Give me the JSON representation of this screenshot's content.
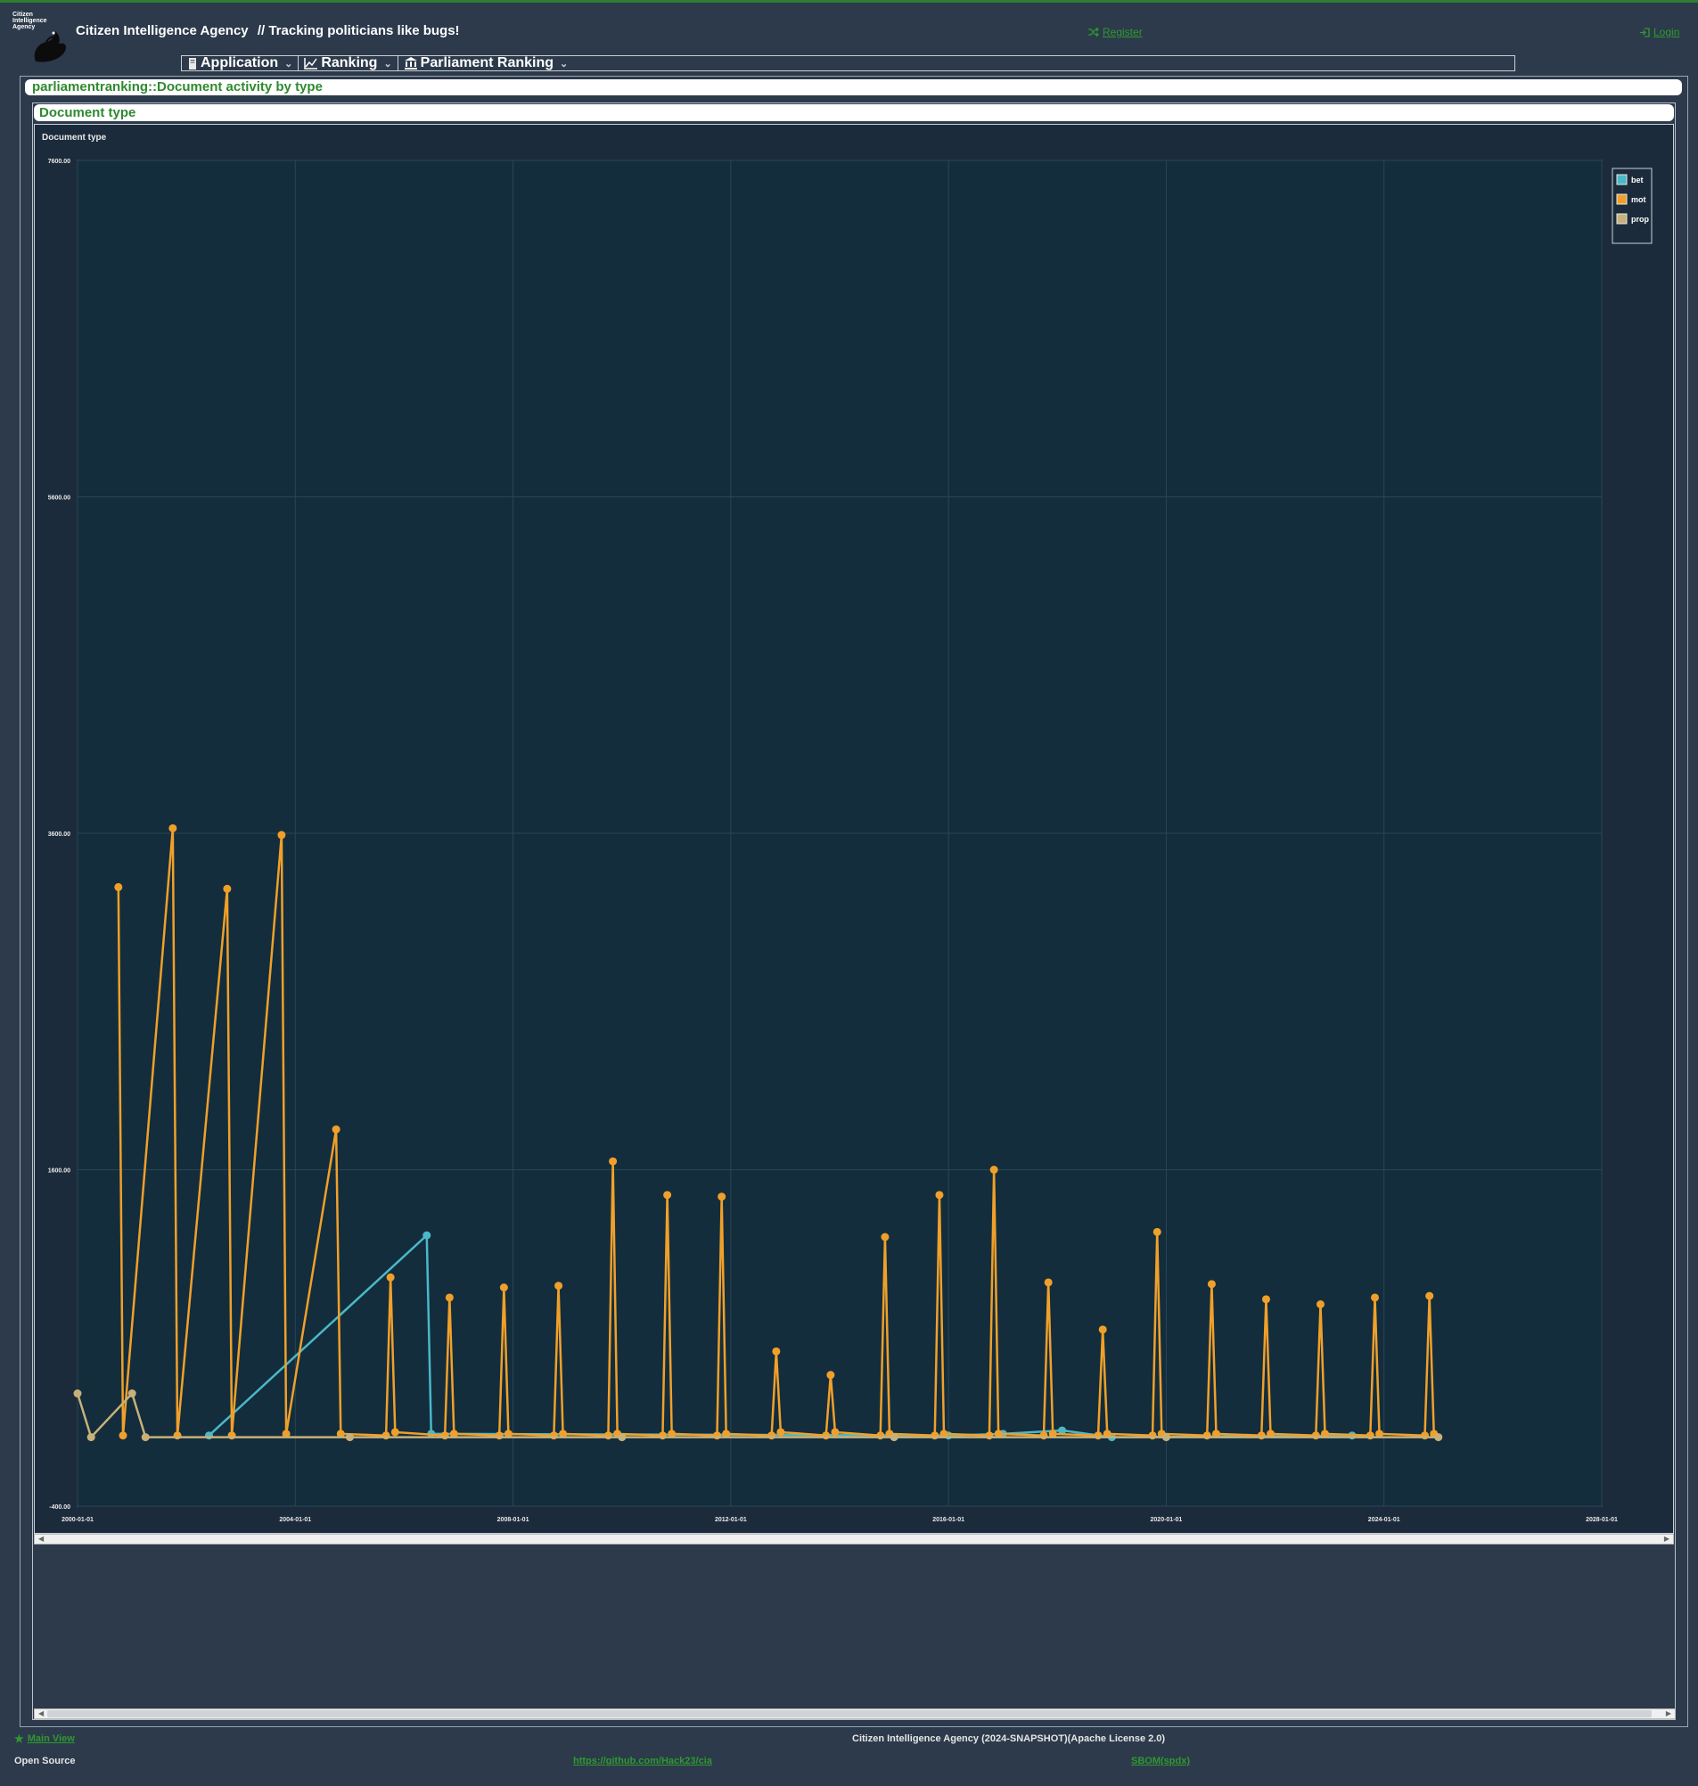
{
  "header": {
    "logo_text": "Citizen Intelligence Agency",
    "title": "Citizen Intelligence Agency",
    "tagline": "// Tracking politicians like bugs!",
    "register_label": "Register",
    "login_label": "Login"
  },
  "menu": [
    {
      "label": "Application",
      "icon": "document-icon"
    },
    {
      "label": "Ranking",
      "icon": "line-chart-icon"
    },
    {
      "label": "Parliament Ranking",
      "icon": "institution-icon"
    }
  ],
  "page_header": "parliamentranking::Document activity by type",
  "panel_header": "Document type",
  "chart_data": {
    "type": "line",
    "title": "Document type",
    "xlabel": "",
    "ylabel": "",
    "x_ticks": [
      "2000-01-01",
      "2004-01-01",
      "2008-01-01",
      "2012-01-01",
      "2016-01-01",
      "2020-01-01",
      "2024-01-01",
      "2028-01-01"
    ],
    "y_ticks": [
      "7600.00",
      "5600.00",
      "3600.00",
      "1600.00",
      "-400.00"
    ],
    "xlim": [
      "2000-01-01",
      "2028-01-01"
    ],
    "ylim": [
      -400,
      7600
    ],
    "grid": true,
    "legend_position": "top-right",
    "series": [
      {
        "name": "bet",
        "color": "#4ab8c8",
        "points": [
          [
            "2002-06-01",
            20
          ],
          [
            "2006-06-01",
            1210
          ],
          [
            "2006-07-01",
            30
          ],
          [
            "2016-01-01",
            20
          ],
          [
            "2017-01-01",
            30
          ],
          [
            "2018-02-01",
            50
          ],
          [
            "2019-01-01",
            10
          ],
          [
            "2023-06-01",
            20
          ]
        ]
      },
      {
        "name": "mot",
        "color": "#f0a02a",
        "points": [
          [
            "2000-10-01",
            3280
          ],
          [
            "2000-11-01",
            20
          ],
          [
            "2001-10-01",
            3630
          ],
          [
            "2001-11-01",
            20
          ],
          [
            "2002-10-01",
            3270
          ],
          [
            "2002-11-01",
            20
          ],
          [
            "2003-10-01",
            3590
          ],
          [
            "2003-11-01",
            30
          ],
          [
            "2004-10-01",
            1840
          ],
          [
            "2004-11-01",
            30
          ],
          [
            "2005-09-01",
            20
          ],
          [
            "2005-10-01",
            960
          ],
          [
            "2005-11-01",
            40
          ],
          [
            "2006-10-01",
            20
          ],
          [
            "2006-11-01",
            840
          ],
          [
            "2006-12-01",
            30
          ],
          [
            "2007-10-01",
            20
          ],
          [
            "2007-11-01",
            900
          ],
          [
            "2007-12-01",
            30
          ],
          [
            "2008-10-01",
            20
          ],
          [
            "2008-11-01",
            910
          ],
          [
            "2008-12-01",
            30
          ],
          [
            "2009-10-01",
            20
          ],
          [
            "2009-11-01",
            1650
          ],
          [
            "2009-12-01",
            30
          ],
          [
            "2010-10-01",
            20
          ],
          [
            "2010-11-01",
            1450
          ],
          [
            "2010-12-01",
            30
          ],
          [
            "2011-10-01",
            20
          ],
          [
            "2011-11-01",
            1440
          ],
          [
            "2011-12-01",
            30
          ],
          [
            "2012-10-01",
            20
          ],
          [
            "2012-11-01",
            520
          ],
          [
            "2012-12-01",
            40
          ],
          [
            "2013-10-01",
            20
          ],
          [
            "2013-11-01",
            380
          ],
          [
            "2013-12-01",
            40
          ],
          [
            "2014-10-01",
            20
          ],
          [
            "2014-11-01",
            1200
          ],
          [
            "2014-12-01",
            30
          ],
          [
            "2015-10-01",
            20
          ],
          [
            "2015-11-01",
            1450
          ],
          [
            "2015-12-01",
            30
          ],
          [
            "2016-10-01",
            20
          ],
          [
            "2016-11-01",
            1600
          ],
          [
            "2016-12-01",
            30
          ],
          [
            "2017-10-01",
            20
          ],
          [
            "2017-11-01",
            930
          ],
          [
            "2017-12-01",
            30
          ],
          [
            "2018-10-01",
            20
          ],
          [
            "2018-11-01",
            650
          ],
          [
            "2018-12-01",
            30
          ],
          [
            "2019-10-01",
            20
          ],
          [
            "2019-11-01",
            1230
          ],
          [
            "2019-12-01",
            30
          ],
          [
            "2020-10-01",
            20
          ],
          [
            "2020-11-01",
            920
          ],
          [
            "2020-12-01",
            30
          ],
          [
            "2021-10-01",
            20
          ],
          [
            "2021-11-01",
            830
          ],
          [
            "2021-12-01",
            30
          ],
          [
            "2022-10-01",
            20
          ],
          [
            "2022-11-01",
            800
          ],
          [
            "2022-12-01",
            30
          ],
          [
            "2023-10-01",
            20
          ],
          [
            "2023-11-01",
            840
          ],
          [
            "2023-12-01",
            30
          ],
          [
            "2024-10-01",
            20
          ],
          [
            "2024-11-01",
            850
          ],
          [
            "2024-12-01",
            30
          ]
        ]
      },
      {
        "name": "prop",
        "color": "#c8b07a",
        "points": [
          [
            "2000-01-01",
            270
          ],
          [
            "2000-04-01",
            10
          ],
          [
            "2001-01-01",
            270
          ],
          [
            "2001-04-01",
            10
          ],
          [
            "2005-01-01",
            10
          ],
          [
            "2010-01-01",
            10
          ],
          [
            "2015-01-01",
            10
          ],
          [
            "2020-01-01",
            10
          ],
          [
            "2024-12-31",
            10
          ]
        ]
      }
    ]
  },
  "footer": {
    "main_view": "Main View",
    "copyright": "Citizen Intelligence Agency (2024-SNAPSHOT)(Apache License 2.0)",
    "open_source": "Open Source",
    "github": "https://github.com/Hack23/cia",
    "sbom": "SBOM(spdx)"
  }
}
